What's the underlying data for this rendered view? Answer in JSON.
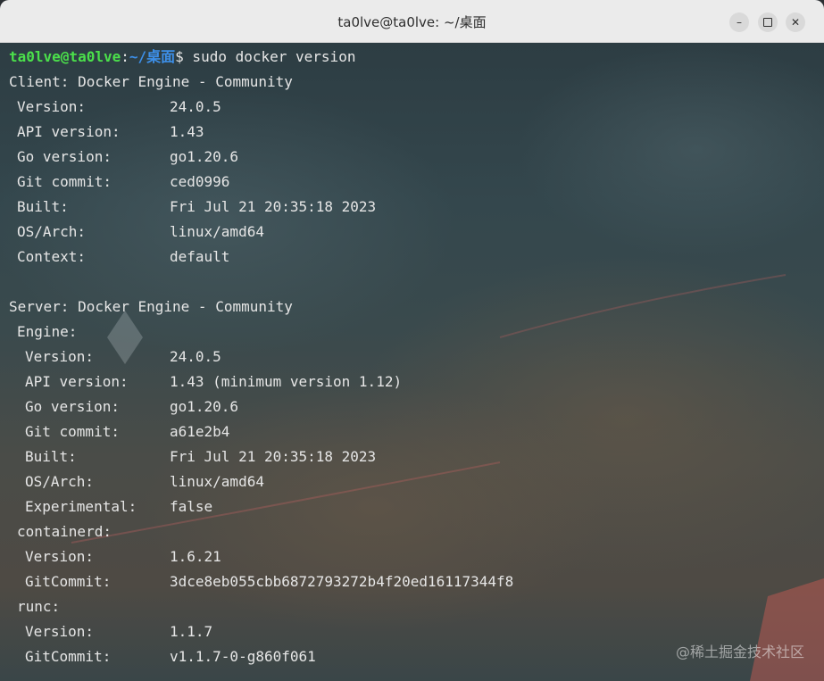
{
  "window": {
    "title": "ta0lve@ta0lve: ~/桌面",
    "minimize_label": "–",
    "close_label": "✕"
  },
  "prompt": {
    "user": "ta0lve@ta0lve",
    "colon": ":",
    "path": "~/桌面",
    "dollar": "$",
    "command": " sudo docker version"
  },
  "client": {
    "header": "Client: Docker Engine - Community",
    "rows": [
      {
        "k": "Version:",
        "v": "24.0.5"
      },
      {
        "k": "API version:",
        "v": "1.43"
      },
      {
        "k": "Go version:",
        "v": "go1.20.6"
      },
      {
        "k": "Git commit:",
        "v": "ced0996"
      },
      {
        "k": "Built:",
        "v": "Fri Jul 21 20:35:18 2023"
      },
      {
        "k": "OS/Arch:",
        "v": "linux/amd64"
      },
      {
        "k": "Context:",
        "v": "default"
      }
    ]
  },
  "server": {
    "header": "Server: Docker Engine - Community",
    "engine_label": "Engine:",
    "engine": [
      {
        "k": "Version:",
        "v": "24.0.5"
      },
      {
        "k": "API version:",
        "v": "1.43 (minimum version 1.12)"
      },
      {
        "k": "Go version:",
        "v": "go1.20.6"
      },
      {
        "k": "Git commit:",
        "v": "a61e2b4"
      },
      {
        "k": "Built:",
        "v": "Fri Jul 21 20:35:18 2023"
      },
      {
        "k": "OS/Arch:",
        "v": "linux/amd64"
      },
      {
        "k": "Experimental:",
        "v": "false"
      }
    ],
    "containerd_label": "containerd:",
    "containerd": [
      {
        "k": "Version:",
        "v": "1.6.21"
      },
      {
        "k": "GitCommit:",
        "v": "3dce8eb055cbb6872793272b4f20ed16117344f8"
      }
    ],
    "runc_label": "runc:",
    "runc": [
      {
        "k": "Version:",
        "v": "1.1.7"
      },
      {
        "k": "GitCommit:",
        "v": "v1.1.7-0-g860f061"
      }
    ]
  },
  "watermark": "@稀土掘金技术社区"
}
